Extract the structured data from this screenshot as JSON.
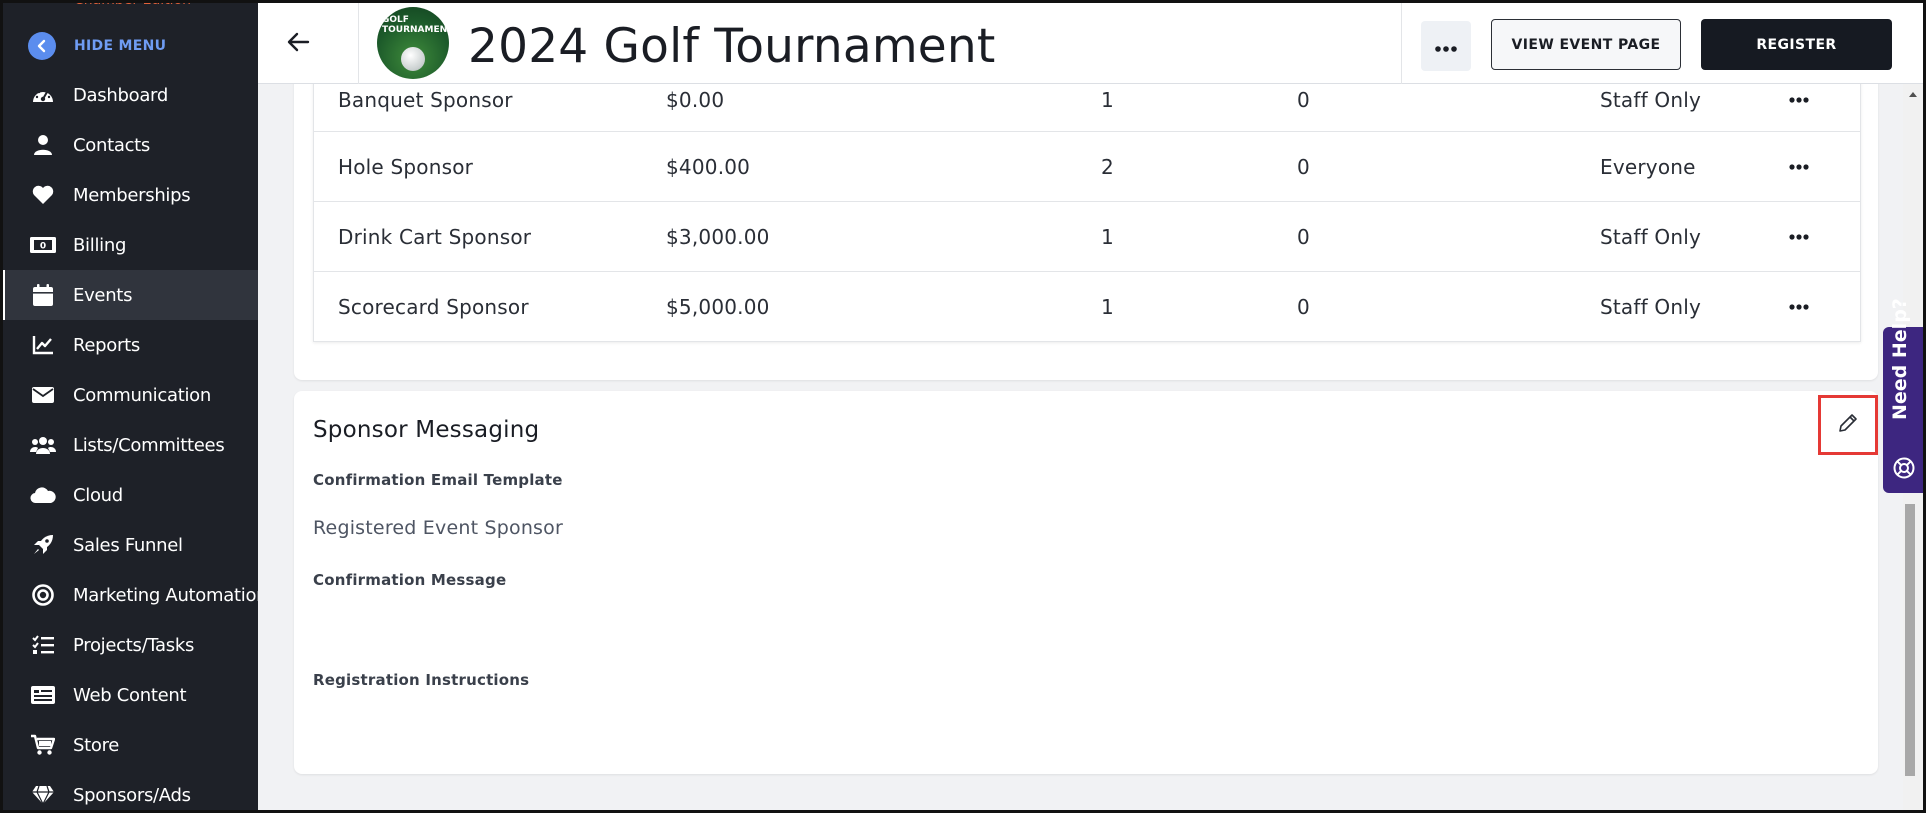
{
  "sidebar": {
    "org_label": "Chamber Edition",
    "hide_menu_label": "HIDE MENU",
    "items": [
      {
        "label": "Dashboard",
        "icon": "dashboard-gauge-icon"
      },
      {
        "label": "Contacts",
        "icon": "person-icon"
      },
      {
        "label": "Memberships",
        "icon": "heart-icon"
      },
      {
        "label": "Billing",
        "icon": "money-bill-icon"
      },
      {
        "label": "Events",
        "icon": "calendar-icon",
        "active": true
      },
      {
        "label": "Reports",
        "icon": "chart-line-icon"
      },
      {
        "label": "Communication",
        "icon": "envelope-icon"
      },
      {
        "label": "Lists/Committees",
        "icon": "users-group-icon"
      },
      {
        "label": "Cloud",
        "icon": "cloud-icon"
      },
      {
        "label": "Sales Funnel",
        "icon": "rocket-icon"
      },
      {
        "label": "Marketing Automation",
        "icon": "target-icon"
      },
      {
        "label": "Projects/Tasks",
        "icon": "checklist-icon"
      },
      {
        "label": "Web Content",
        "icon": "web-content-icon"
      },
      {
        "label": "Store",
        "icon": "cart-icon"
      },
      {
        "label": "Sponsors/Ads",
        "icon": "gem-icon"
      }
    ]
  },
  "header": {
    "title": "2024 Golf Tournament",
    "logo_text": "GOLF TOURNAMENT",
    "view_event_label": "VIEW EVENT PAGE",
    "register_label": "REGISTER"
  },
  "sponsorships": {
    "rows": [
      {
        "name": "Banquet Sponsor",
        "price": "$0.00",
        "quantity": "1",
        "sold": "0",
        "visibility": "Staff Only"
      },
      {
        "name": "Hole Sponsor",
        "price": "$400.00",
        "quantity": "2",
        "sold": "0",
        "visibility": "Everyone"
      },
      {
        "name": "Drink Cart Sponsor",
        "price": "$3,000.00",
        "quantity": "1",
        "sold": "0",
        "visibility": "Staff Only"
      },
      {
        "name": "Scorecard Sponsor",
        "price": "$5,000.00",
        "quantity": "1",
        "sold": "0",
        "visibility": "Staff Only"
      }
    ]
  },
  "sponsor_messaging": {
    "title": "Sponsor Messaging",
    "email_template_label": "Confirmation Email Template",
    "email_template_value": "Registered Event Sponsor",
    "confirmation_message_label": "Confirmation Message",
    "confirmation_message_value": "",
    "registration_instructions_label": "Registration Instructions",
    "registration_instructions_value": ""
  },
  "help": {
    "label": "Need Help?"
  },
  "colors": {
    "sidebar_bg": "#1e2128",
    "accent_blue": "#5b8dee",
    "register_bg": "#161a22",
    "help_purple": "#3d2680",
    "highlight_red": "#e53935"
  }
}
